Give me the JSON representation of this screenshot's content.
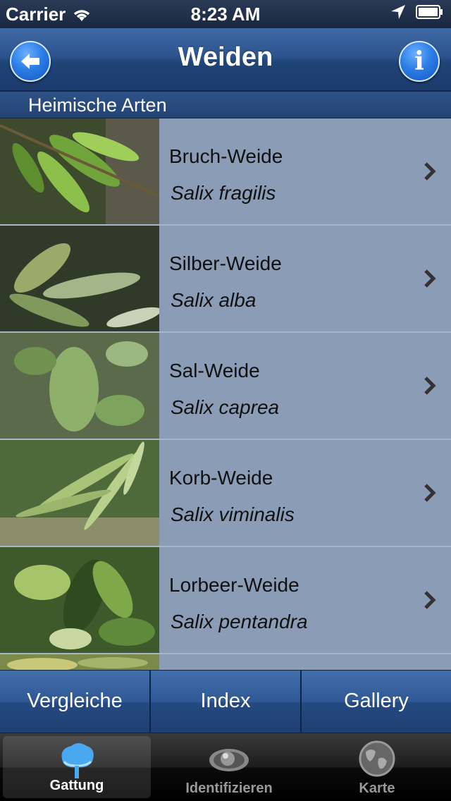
{
  "status_bar": {
    "carrier": "Carrier",
    "time": "8:23 AM"
  },
  "nav": {
    "title": "Weiden",
    "back_icon": "back-arrow-icon",
    "info_icon": "info-icon",
    "info_glyph": "i"
  },
  "section": {
    "title": "Heimische Arten"
  },
  "species": [
    {
      "name": "Bruch-Weide",
      "latin": "Salix fragilis"
    },
    {
      "name": "Silber-Weide",
      "latin": "Salix alba"
    },
    {
      "name": "Sal-Weide",
      "latin": "Salix caprea"
    },
    {
      "name": "Korb-Weide",
      "latin": "Salix viminalis"
    },
    {
      "name": "Lorbeer-Weide",
      "latin": "Salix pentandra"
    },
    {
      "name": "",
      "latin": ""
    }
  ],
  "segments": [
    "Vergleiche",
    "Index",
    "Gallery"
  ],
  "tabs": [
    {
      "label": "Gattung",
      "icon": "tree-icon",
      "active": true
    },
    {
      "label": "Identifizieren",
      "icon": "eye-icon",
      "active": false
    },
    {
      "label": "Karte",
      "icon": "globe-icon",
      "active": false
    }
  ],
  "colors": {
    "nav": "#2c548d",
    "list_bg": "#8b9cb6",
    "accent_button": "#2c7ee6"
  }
}
